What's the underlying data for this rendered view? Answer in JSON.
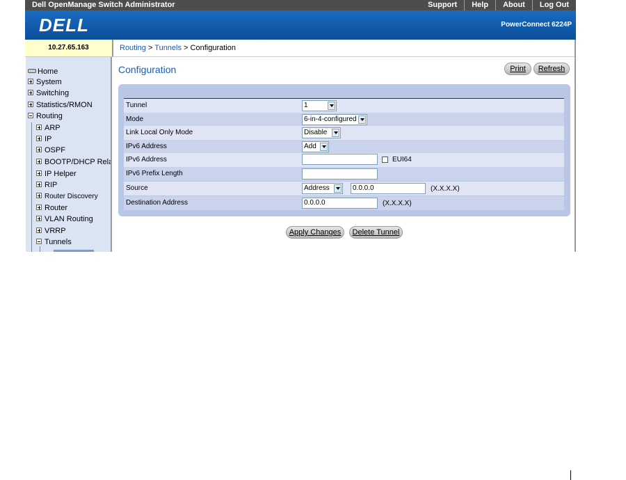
{
  "topbar": {
    "app_title": "Dell OpenManage Switch Administrator",
    "links": [
      "Support",
      "Help",
      "About",
      "Log Out"
    ]
  },
  "header": {
    "logo": "DELL",
    "model": "PowerConnect 6224P"
  },
  "ip_address": "10.27.65.163",
  "breadcrumb": {
    "routing": "Routing",
    "sep1": " > ",
    "tunnels": "Tunnels",
    "sep2": " > ",
    "current": "Configuration"
  },
  "sidebar": {
    "items": [
      {
        "label": "Home"
      },
      {
        "label": "System"
      },
      {
        "label": "Switching"
      },
      {
        "label": "Statistics/RMON"
      },
      {
        "label": "Routing"
      },
      {
        "label": "ARP"
      },
      {
        "label": "IP"
      },
      {
        "label": "OSPF"
      },
      {
        "label": "BOOTP/DHCP Relay A"
      },
      {
        "label": "IP Helper"
      },
      {
        "label": "RIP"
      },
      {
        "label": "Router Discovery"
      },
      {
        "label": "Router"
      },
      {
        "label": "VLAN Routing"
      },
      {
        "label": "VRRP"
      },
      {
        "label": "Tunnels"
      }
    ]
  },
  "page": {
    "title": "Configuration",
    "print_label": "Print",
    "refresh_label": "Refresh"
  },
  "form": {
    "tunnel_label": "Tunnel",
    "tunnel_value": "1",
    "mode_label": "Mode",
    "mode_value": "6-in-4-configured",
    "link_local_label": "Link Local Only Mode",
    "link_local_value": "Disable",
    "ipv6_address_action_label": "IPv6 Address",
    "ipv6_address_action_value": "Add",
    "ipv6_address_label": "IPv6 Address",
    "ipv6_address_value": "",
    "eui64_label": "EUI64",
    "prefix_length_label": "IPv6 Prefix Length",
    "prefix_length_value": "",
    "source_label": "Source",
    "source_type_value": "Address",
    "source_address_value": "0.0.0.0",
    "source_hint": "(X.X.X.X)",
    "destination_label": "Destination Address",
    "destination_value": "0.0.0.0",
    "destination_hint": "(X.X.X.X)"
  },
  "actions": {
    "apply_label": "Apply Changes",
    "delete_label": "Delete Tunnel"
  }
}
